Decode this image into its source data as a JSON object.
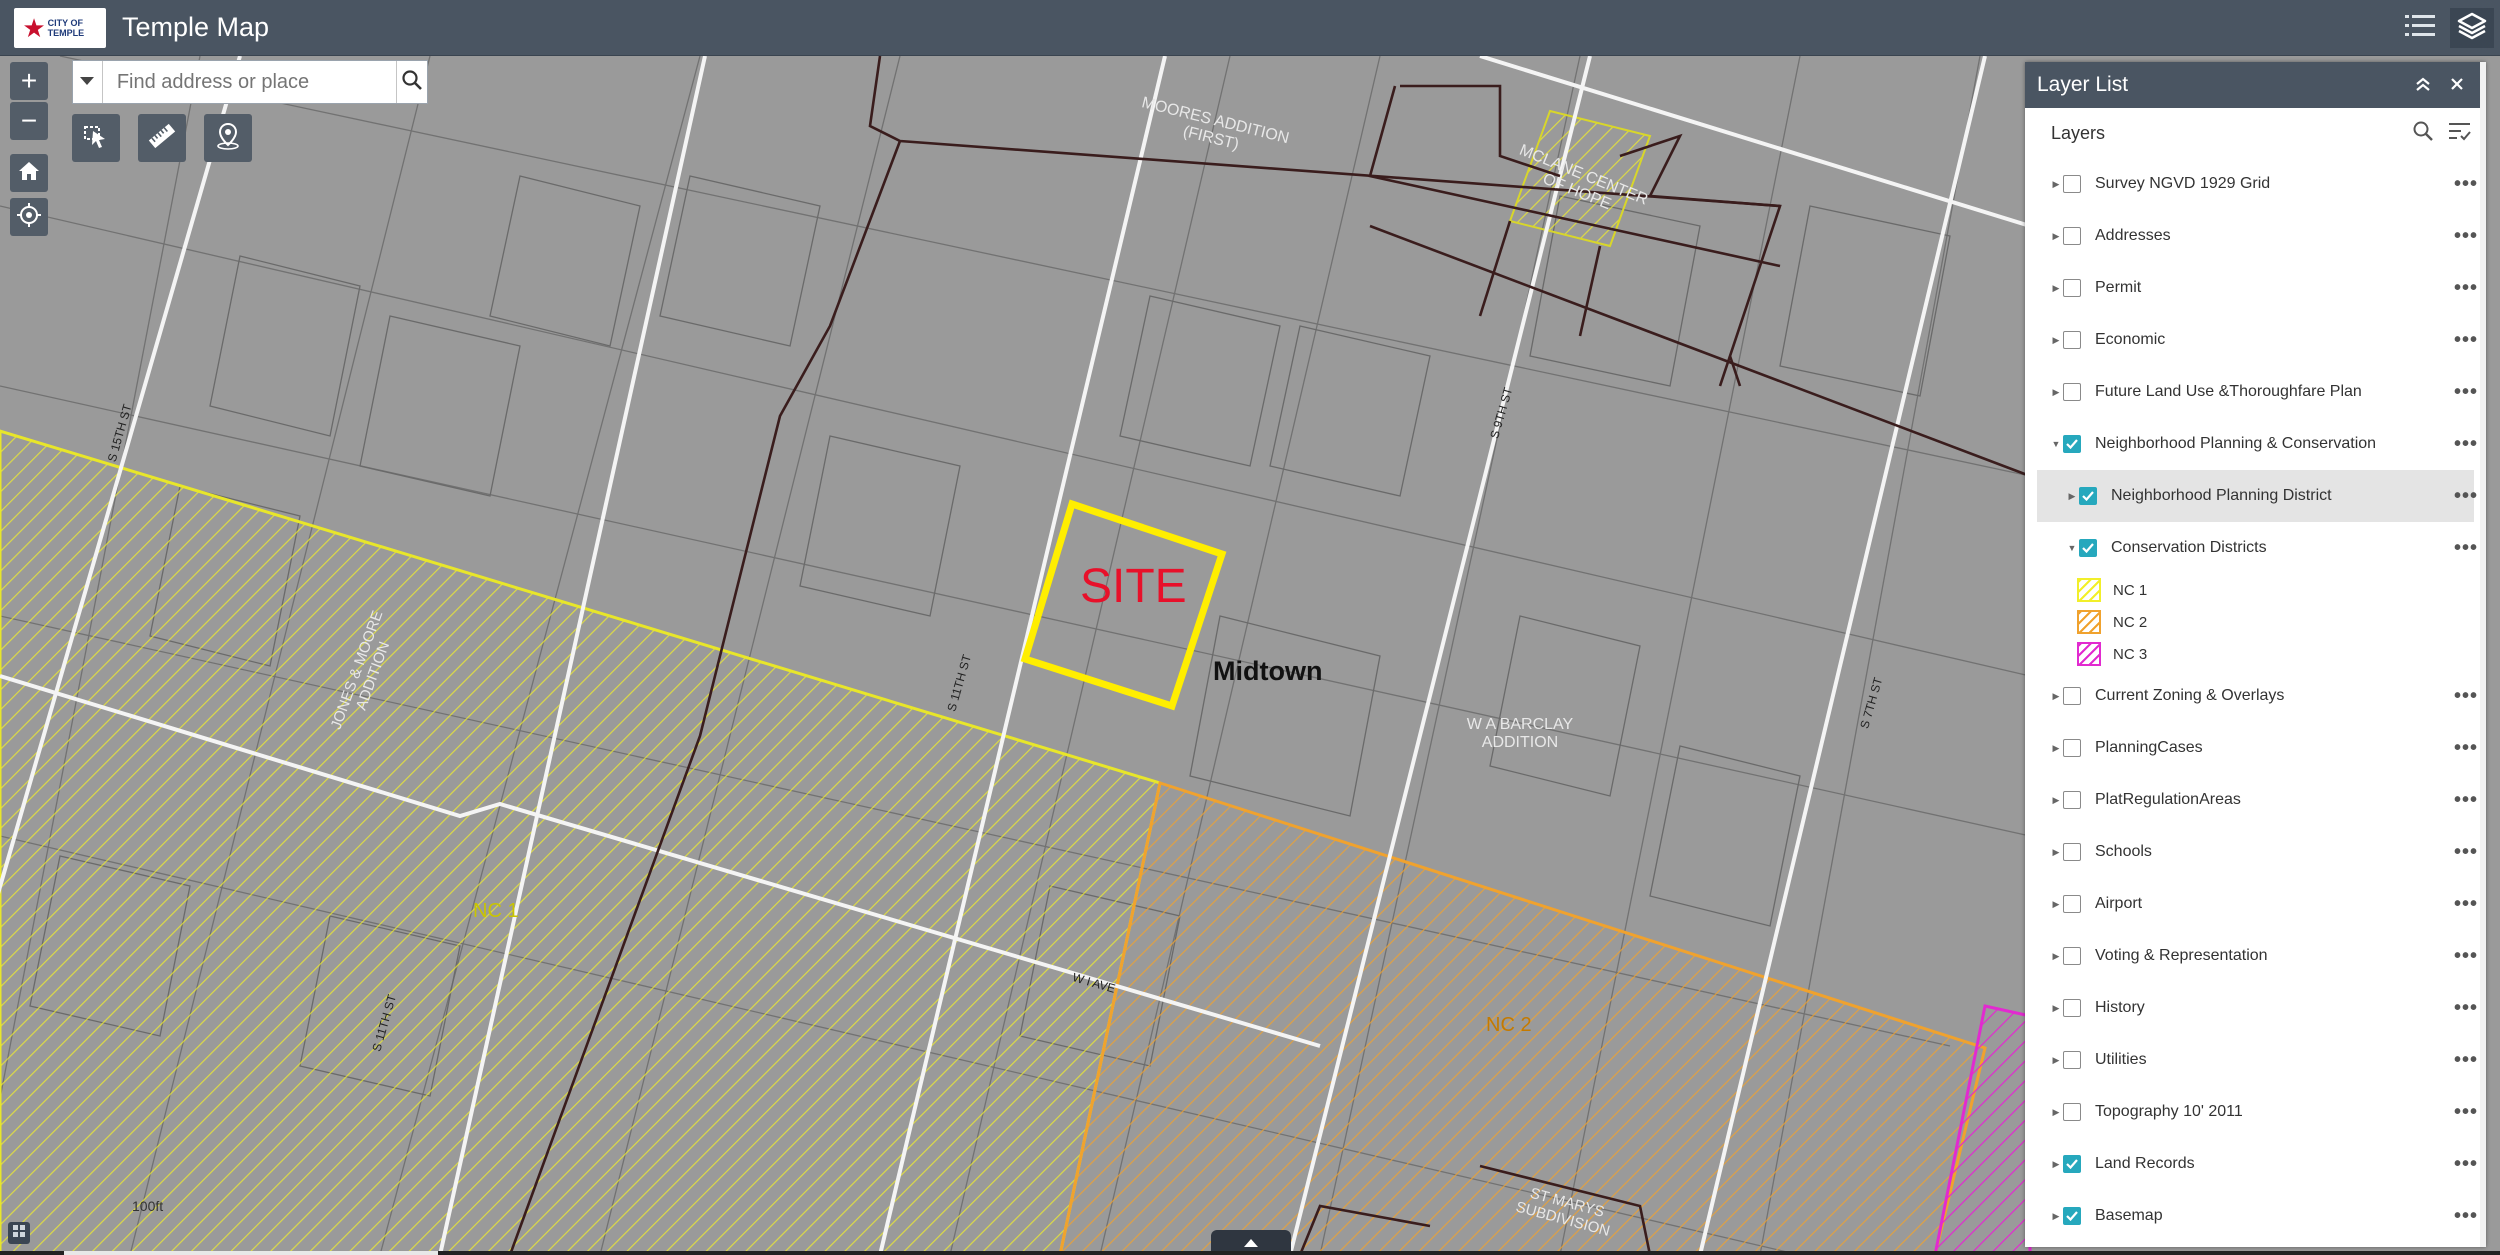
{
  "app": {
    "title": "Temple Map",
    "logo_text": "CITY OF TEMPLE"
  },
  "header": {
    "buttons": [
      {
        "icon": "list-icon"
      },
      {
        "icon": "layers-icon",
        "active": true
      }
    ]
  },
  "search": {
    "placeholder": "Find address or place",
    "value": ""
  },
  "map_controls": {
    "zoom_in": "+",
    "zoom_out": "−"
  },
  "map_labels": {
    "site": "SITE",
    "midtown": "Midtown",
    "nc1": "NC 1",
    "nc2": "NC 2",
    "moores": "MOORES ADDITION (FIRST)",
    "mclane": "MCLANE CENTER OF HOPE",
    "jones": "JONES & MOORE ADDITION",
    "barclay": "W A BARCLAY ADDITION",
    "stmarys": "ST MARYS SUBDIVISION",
    "s15": "S 15TH ST",
    "s11a": "S 11TH ST",
    "s11b": "S 11TH ST",
    "s9": "S 9TH ST",
    "s7": "S 7TH ST",
    "wiave": "W I AVE"
  },
  "scale": {
    "label": "100ft"
  },
  "colors": {
    "nc1": "#f2ef2a",
    "nc2": "#f0a22e",
    "nc3": "#e22ad0",
    "site": "#ffee00",
    "accent": "#26a8bd",
    "header": "#4a5562"
  },
  "layer_list": {
    "title": "Layer List",
    "section": "Layers",
    "layers": [
      {
        "label": "Survey NGVD 1929 Grid",
        "checked": false,
        "level": 0
      },
      {
        "label": "Addresses",
        "checked": false,
        "level": 0
      },
      {
        "label": "Permit",
        "checked": false,
        "level": 0
      },
      {
        "label": "Economic",
        "checked": false,
        "level": 0
      },
      {
        "label": "Future Land Use &Thoroughfare Plan",
        "checked": false,
        "level": 0
      },
      {
        "label": "Neighborhood Planning & Conservation",
        "checked": true,
        "level": 0,
        "expanded": true
      },
      {
        "label": "Neighborhood Planning District",
        "checked": true,
        "level": 1,
        "selected": true
      },
      {
        "label": "Conservation Districts",
        "checked": true,
        "level": 1,
        "expanded": true
      },
      {
        "label": "Current Zoning & Overlays",
        "checked": false,
        "level": 0
      },
      {
        "label": "PlanningCases",
        "checked": false,
        "level": 0
      },
      {
        "label": "PlatRegulationAreas",
        "checked": false,
        "level": 0
      },
      {
        "label": "Schools",
        "checked": false,
        "level": 0
      },
      {
        "label": "Airport",
        "checked": false,
        "level": 0
      },
      {
        "label": "Voting & Representation",
        "checked": false,
        "level": 0
      },
      {
        "label": "History",
        "checked": false,
        "level": 0
      },
      {
        "label": "Utilities",
        "checked": false,
        "level": 0
      },
      {
        "label": "Topography 10' 2011",
        "checked": false,
        "level": 0
      },
      {
        "label": "Land Records",
        "checked": true,
        "level": 0
      },
      {
        "label": "Basemap",
        "checked": true,
        "level": 0
      }
    ],
    "legend": [
      {
        "label": "NC 1",
        "color": "#f2ef2a"
      },
      {
        "label": "NC 2",
        "color": "#f0a22e"
      },
      {
        "label": "NC 3",
        "color": "#e22ad0"
      }
    ]
  }
}
